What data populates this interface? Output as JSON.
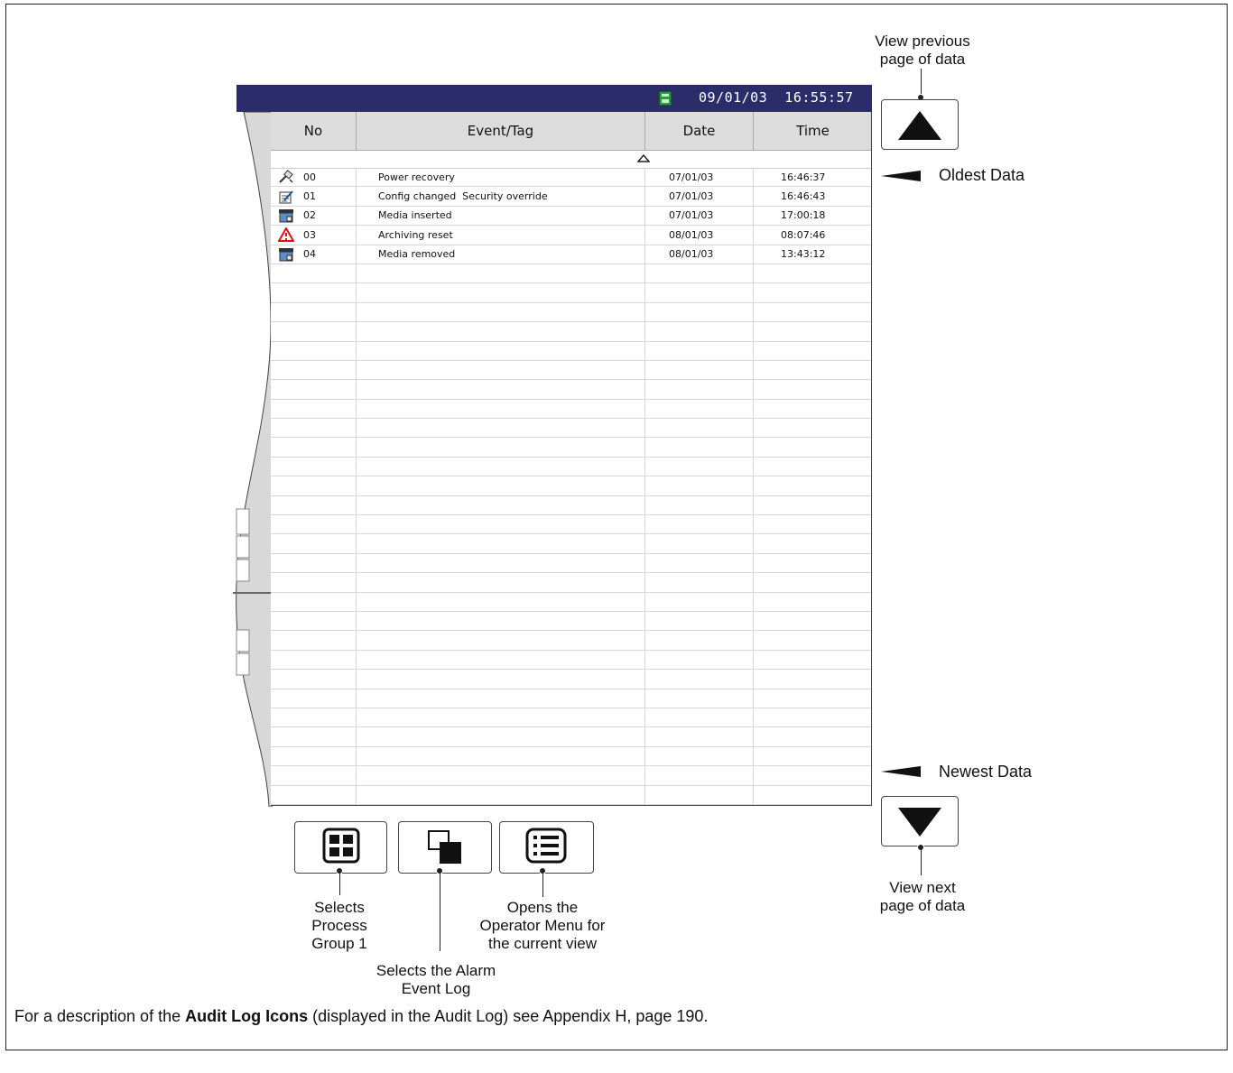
{
  "titlebar": {
    "datetime": "09/01/03  16:55:57"
  },
  "table": {
    "headers": {
      "no": "No",
      "event": "Event/Tag",
      "date": "Date",
      "time": "Time"
    },
    "rows": [
      {
        "icon": "power-recovery-icon",
        "no": "00",
        "event": "Power recovery",
        "date": "07/01/03",
        "time": "16:46:37"
      },
      {
        "icon": "config-changed-icon",
        "no": "01",
        "event": "Config changed  Security override",
        "date": "07/01/03",
        "time": "16:46:43"
      },
      {
        "icon": "media-icon",
        "no": "02",
        "event": "Media inserted",
        "date": "07/01/03",
        "time": "17:00:18"
      },
      {
        "icon": "warning-icon",
        "no": "03",
        "event": "Archiving reset",
        "date": "08/01/03",
        "time": "08:07:46"
      },
      {
        "icon": "media-icon",
        "no": "04",
        "event": "Media removed",
        "date": "08/01/03",
        "time": "13:43:12"
      }
    ]
  },
  "annotations": {
    "prev_page": "View previous\npage of data",
    "next_page": "View next\npage of data",
    "oldest": "Oldest Data",
    "newest": "Newest Data",
    "process_group": "Selects\nProcess\nGroup 1",
    "alarm_log": "Selects the Alarm\nEvent Log",
    "operator_menu": "Opens the\nOperator Menu for\nthe current view"
  },
  "footer": {
    "pre": "For a description of the ",
    "bold": "Audit Log Icons",
    "post": " (displayed in the Audit Log) see Appendix H, page 190."
  }
}
